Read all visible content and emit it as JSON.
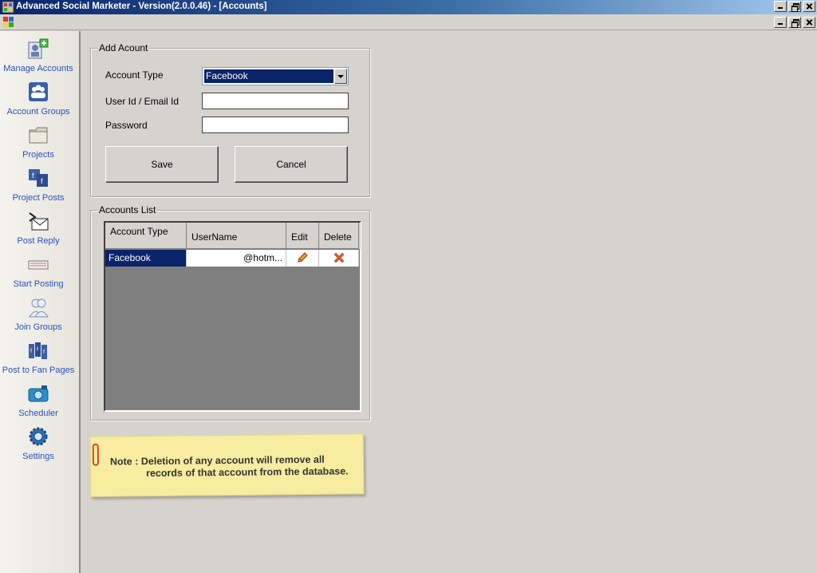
{
  "window": {
    "title": "Advanced Social Marketer - Version(2.0.0.46) - [Accounts]"
  },
  "sidebar": {
    "items": [
      {
        "label": "Manage Accounts",
        "icon": "manage-accounts-icon"
      },
      {
        "label": "Account Groups",
        "icon": "account-groups-icon"
      },
      {
        "label": "Projects",
        "icon": "folder-icon"
      },
      {
        "label": "Project Posts",
        "icon": "project-posts-icon"
      },
      {
        "label": "Post Reply",
        "icon": "envelope-icon"
      },
      {
        "label": "Start Posting",
        "icon": "keyboard-icon"
      },
      {
        "label": "Join Groups",
        "icon": "users-icon"
      },
      {
        "label": "Post to Fan Pages",
        "icon": "fan-pages-icon"
      },
      {
        "label": "Scheduler",
        "icon": "camera-icon"
      },
      {
        "label": "Settings",
        "icon": "gear-icon"
      }
    ]
  },
  "add_account": {
    "title": "Add Acount",
    "account_type_label": "Account Type",
    "account_type_value": "Facebook",
    "user_label": "User Id / Email Id",
    "user_value": "",
    "password_label": "Password",
    "password_value": "",
    "save_label": "Save",
    "cancel_label": "Cancel"
  },
  "accounts_list": {
    "title": "Accounts List",
    "columns": [
      "Account Type",
      "UserName",
      "Edit",
      "Delete"
    ],
    "rows": [
      {
        "account_type": "Facebook",
        "username": "@hotm..."
      }
    ]
  },
  "note": {
    "line1": "Note : Deletion of any account will remove all",
    "line2": "records of that account from the database."
  },
  "colors": {
    "accent": "#0a246a",
    "sidebar_text": "#2a52be",
    "note_bg": "#f8eca0"
  }
}
